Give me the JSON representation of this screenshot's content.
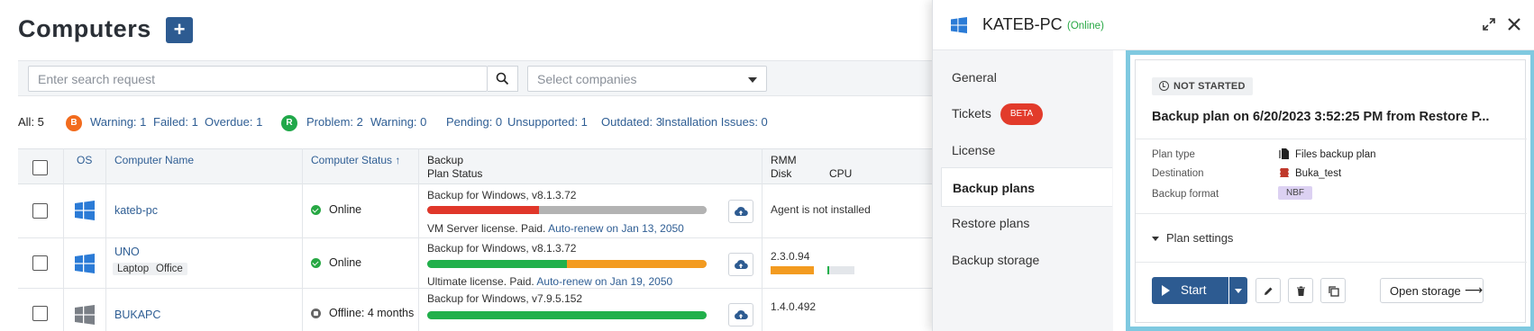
{
  "page": {
    "title": "Computers",
    "add_button": "+"
  },
  "search": {
    "placeholder": "Enter search request"
  },
  "companies": {
    "placeholder": "Select companies"
  },
  "stats": {
    "all": "All: 5",
    "warning1": "Warning: 1",
    "failed": "Failed: 1",
    "overdue": "Overdue: 1",
    "problem": "Problem: 2",
    "warning2": "Warning: 0",
    "pending": "Pending: 0",
    "unsupported": "Unsupported: 1",
    "outdated": "Outdated: 3",
    "install_issues": "Installation Issues: 0",
    "backup_icon_letter": "B",
    "rmm_icon_letter": "R"
  },
  "table": {
    "headers": {
      "os": "OS",
      "name": "Computer Name",
      "status": "Computer Status ↑",
      "backup": "Backup",
      "plan_status": "Plan Status",
      "rmm": "RMM",
      "disk": "Disk",
      "cpu": "CPU"
    },
    "rows": [
      {
        "name": "kateb-pc",
        "status": "Online",
        "backup_title": "Backup for Windows, v8.1.3.72",
        "license_text": "VM Server license. Paid.",
        "license_link": "Auto-renew on Jan 13, 2050",
        "bar": {
          "segments": [
            {
              "color": "#e0372a",
              "fraction": 0.4
            },
            {
              "color": "#b3b3b3",
              "fraction": 0.6
            }
          ]
        },
        "rmm_text": "Agent is not installed"
      },
      {
        "name": "UNO",
        "tags": [
          "Laptop",
          "Office"
        ],
        "status": "Online",
        "backup_title": "Backup for Windows, v8.1.3.72",
        "license_text": "Ultimate license. Paid.",
        "license_link": "Auto-renew on Jan 19, 2050",
        "bar": {
          "segments": [
            {
              "color": "#21b04b",
              "fraction": 0.5
            },
            {
              "color": "#f39b20",
              "fraction": 0.5
            }
          ]
        },
        "rmm_text": "2.3.0.94"
      },
      {
        "name": "BUKAPC",
        "status": "Offline: 4 months",
        "backup_title": "Backup for Windows, v7.9.5.152",
        "bar": {
          "segments": [
            {
              "color": "#21b04b",
              "fraction": 1.0
            }
          ]
        },
        "rmm_text": "1.4.0.492"
      }
    ]
  },
  "drawer": {
    "computer_name": "KATEB-PC",
    "online_label": "(Online)",
    "nav": [
      "General",
      "Tickets",
      "License",
      "Backup plans",
      "Restore plans",
      "Backup storage"
    ],
    "beta": "BETA",
    "active_nav": "Backup plans",
    "plan": {
      "status": "NOT STARTED",
      "title": "Backup plan on 6/20/2023 3:52:25 PM from Restore P...",
      "plan_type_label": "Plan type",
      "plan_type": "Files backup plan",
      "destination_label": "Destination",
      "destination": "Buka_test",
      "format_label": "Backup format",
      "format": "NBF",
      "settings_label": "Plan settings",
      "start_label": "Start",
      "open_storage_label": "Open storage",
      "open_storage_arrow": "⟶"
    }
  },
  "colors": {
    "primary": "#2d5b91",
    "link": "#2f5e94",
    "online": "#27a844",
    "beta": "#e23b2b",
    "highlight_border": "#7fc9e0",
    "nbf_badge": "#dcd1f2"
  }
}
